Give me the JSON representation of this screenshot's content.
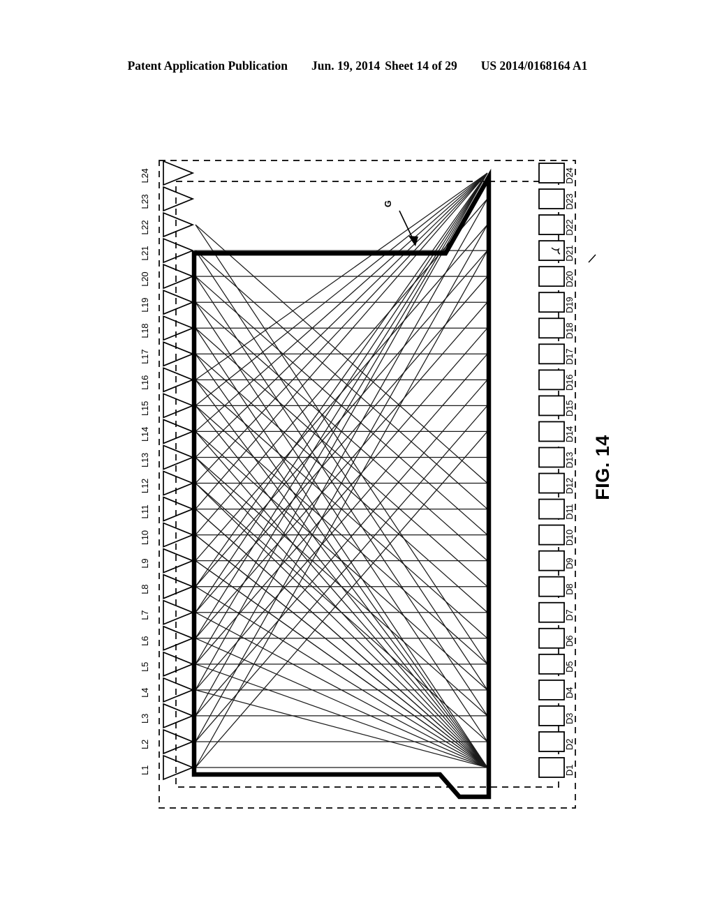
{
  "header": {
    "publication": "Patent Application Publication",
    "date": "Jun. 19, 2014",
    "sheet": "Sheet 14 of 29",
    "patent_number": "US 2014/0168164 A1"
  },
  "figure": {
    "caption": "FIG. 14",
    "callout_label": "G",
    "left_ports": [
      "L1",
      "L2",
      "L3",
      "L4",
      "L5",
      "L6",
      "L7",
      "L8",
      "L9",
      "L10",
      "L11",
      "L12",
      "L13",
      "L14",
      "L15",
      "L16",
      "L17",
      "L18",
      "L19",
      "L20",
      "L21",
      "L22",
      "L23",
      "L24"
    ],
    "right_ports": [
      "D1",
      "D2",
      "D3",
      "D4",
      "D5",
      "D6",
      "D7",
      "D8",
      "D9",
      "D10",
      "D11",
      "D12",
      "D13",
      "D14",
      "D15",
      "D16",
      "D17",
      "D18",
      "D19",
      "D20",
      "D21",
      "D22",
      "D23",
      "D24"
    ],
    "colors": {
      "ink": "#000000",
      "paper": "#ffffff",
      "thin_line": "#1a1a1a"
    },
    "line_counts": {
      "left_port_triangles": 24,
      "right_port_boxes": 24,
      "horizontal_rails": 24
    }
  }
}
